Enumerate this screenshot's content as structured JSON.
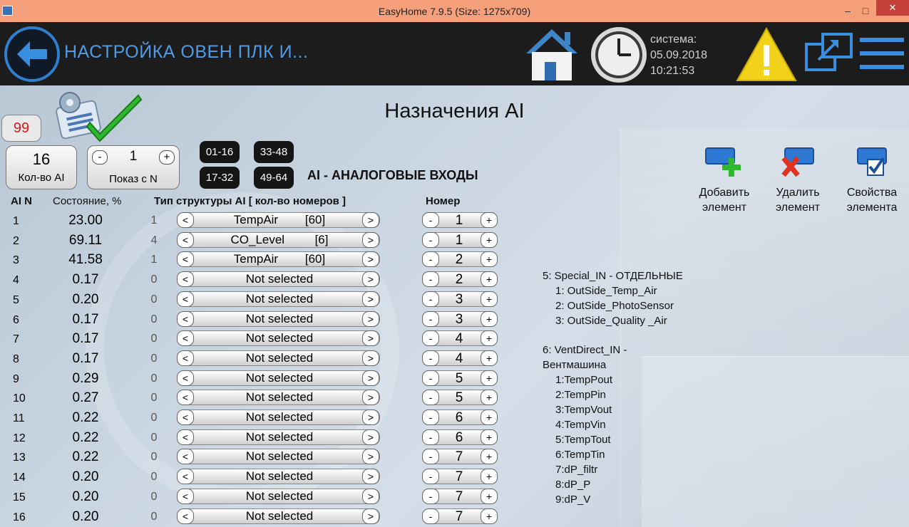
{
  "window": {
    "title": "EasyHome 7.9.5 (Size: 1275x709)",
    "minimize": "–",
    "maximize": "□",
    "close": "✕"
  },
  "header": {
    "screen_title": "НАСТРОЙКА ОВЕН ПЛК И...",
    "system_label": "система:",
    "date": "05.09.2018",
    "time": "10:21:53"
  },
  "page": {
    "title": "Назначения AI",
    "badge": "99",
    "section_title": "AI - АНАЛОГОВЫЕ ВХОДЫ"
  },
  "count": {
    "value": "16",
    "label": "Кол-во AI"
  },
  "show_from": {
    "minus": "-",
    "value": "1",
    "plus": "+",
    "label": "Показ с N"
  },
  "ranges": [
    "01-16",
    "33-48",
    "17-32",
    "49-64"
  ],
  "actions": {
    "add": "Добавить элемент",
    "delete": "Удалить элемент",
    "props": "Свойства элемента"
  },
  "columns": {
    "ai_n": "AI N",
    "state": "Состояние, %",
    "type": "Тип структуры AI [ кол-во номеров ]",
    "number": "Номер"
  },
  "controls": {
    "prev": "<",
    "next": ">",
    "minus": "-",
    "plus": "+"
  },
  "rows": [
    {
      "n": "1",
      "state": "23.00",
      "count": "1",
      "type": "TempAir        [60]",
      "num": "1"
    },
    {
      "n": "2",
      "state": "69.11",
      "count": "4",
      "type": "CO_Level         [6]",
      "num": "1"
    },
    {
      "n": "3",
      "state": "41.58",
      "count": "1",
      "type": "TempAir        [60]",
      "num": "2"
    },
    {
      "n": "4",
      "state": "0.17",
      "count": "0",
      "type": "Not selected",
      "num": "2"
    },
    {
      "n": "5",
      "state": "0.20",
      "count": "0",
      "type": "Not selected",
      "num": "3"
    },
    {
      "n": "6",
      "state": "0.17",
      "count": "0",
      "type": "Not selected",
      "num": "3"
    },
    {
      "n": "7",
      "state": "0.17",
      "count": "0",
      "type": "Not selected",
      "num": "4"
    },
    {
      "n": "8",
      "state": "0.17",
      "count": "0",
      "type": "Not selected",
      "num": "4"
    },
    {
      "n": "9",
      "state": "0.29",
      "count": "0",
      "type": "Not selected",
      "num": "5"
    },
    {
      "n": "10",
      "state": "0.27",
      "count": "0",
      "type": "Not selected",
      "num": "5"
    },
    {
      "n": "11",
      "state": "0.22",
      "count": "0",
      "type": "Not selected",
      "num": "6"
    },
    {
      "n": "12",
      "state": "0.22",
      "count": "0",
      "type": "Not selected",
      "num": "6"
    },
    {
      "n": "13",
      "state": "0.22",
      "count": "0",
      "type": "Not selected",
      "num": "7"
    },
    {
      "n": "14",
      "state": "0.20",
      "count": "0",
      "type": "Not selected",
      "num": "7"
    },
    {
      "n": "15",
      "state": "0.20",
      "count": "0",
      "type": "Not selected",
      "num": "7"
    },
    {
      "n": "16",
      "state": "0.20",
      "count": "0",
      "type": "Not selected",
      "num": "7"
    }
  ],
  "info": {
    "special_title": "5: Special_IN - ОТДЕЛЬНЫЕ",
    "special_items": [
      "1: OutSide_Temp_Air",
      "2: OutSide_PhotoSensor",
      "3: OutSide_Quality _Air"
    ],
    "vent_title_1": "6: VentDirect_IN -",
    "vent_title_2": "Вентмашина",
    "vent_items": [
      "1:TempPout",
      "2:TempPin",
      "3:TempVout",
      "4:TempVin",
      "5:TempTout",
      "6:TempTin",
      "7:dP_filtr",
      "8:dP_P",
      "9:dP_V"
    ]
  },
  "colors": {
    "titlebar": "#f5a07a",
    "header_bg": "#1c1c1c",
    "accent_blue": "#4f9be6",
    "state_red": "#d21b1b"
  }
}
